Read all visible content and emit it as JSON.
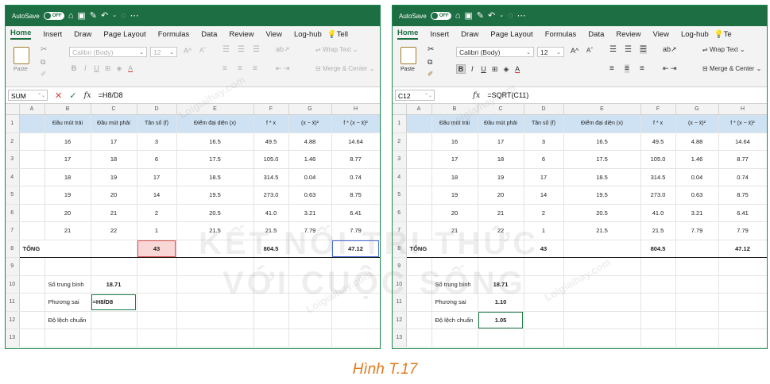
{
  "windows": [
    {
      "id": "left",
      "titlebar": {
        "autosave": "AutoSave",
        "toggle": "OFF"
      },
      "tabs": [
        "Home",
        "Insert",
        "Draw",
        "Page Layout",
        "Formulas",
        "Data",
        "Review",
        "View",
        "Log-hub",
        "Tell"
      ],
      "ribbon": {
        "paste": "Paste",
        "font_name": "Calibri (Body)",
        "font_size": "12",
        "wrap_text": "Wrap Text",
        "merge_center": "Merge & Center",
        "font_letter": "A",
        "bold": "B",
        "italic": "I",
        "underline": "U"
      },
      "formula_bar": {
        "name_box": "SUM",
        "fx": "fx",
        "cancel": "✕",
        "enter": "✓",
        "content": "=H8/D8"
      },
      "selected_cells": [
        "D8",
        "H8",
        "C11"
      ],
      "edit_cell": "C11"
    },
    {
      "id": "right",
      "titlebar": {
        "autosave": "AutoSave",
        "toggle": "OFF"
      },
      "tabs": [
        "Home",
        "Insert",
        "Draw",
        "Page Layout",
        "Formulas",
        "Data",
        "Review",
        "View",
        "Log-hub",
        "Te"
      ],
      "ribbon": {
        "paste": "Paste",
        "font_name": "Calibri (Body)",
        "font_size": "12",
        "wrap_text": "Wrap Text",
        "merge_center": "Merge & Center",
        "font_letter": "A",
        "bold": "B",
        "italic": "I",
        "underline": "U"
      },
      "formula_bar": {
        "name_box": "C12",
        "fx": "fx",
        "cancel": "",
        "enter": "",
        "content": "=SQRT(C11)"
      },
      "selected_cells": [
        "C12"
      ],
      "edit_cell": ""
    }
  ],
  "sheet": {
    "columns": [
      "A",
      "B",
      "C",
      "D",
      "E",
      "F",
      "G",
      "H"
    ],
    "row_numbers": [
      "1",
      "2",
      "3",
      "4",
      "5",
      "6",
      "7",
      "8",
      "9",
      "10",
      "11",
      "12",
      "13"
    ],
    "headers": [
      "Đầu mút trái",
      "Đầu mút phải",
      "Tần số (f)",
      "Điểm đại diện (x)",
      "f * x",
      "(x − x̄)²",
      "f * (x − x̄)²"
    ],
    "rows": [
      [
        "16",
        "17",
        "3",
        "16.5",
        "49.5",
        "4.88",
        "14.64"
      ],
      [
        "17",
        "18",
        "6",
        "17.5",
        "105.0",
        "1.46",
        "8.77"
      ],
      [
        "18",
        "19",
        "17",
        "18.5",
        "314.5",
        "0.04",
        "0.74"
      ],
      [
        "19",
        "20",
        "14",
        "19.5",
        "273.0",
        "0.63",
        "8.75"
      ],
      [
        "20",
        "21",
        "2",
        "20.5",
        "41.0",
        "3.21",
        "6.41"
      ],
      [
        "21",
        "22",
        "1",
        "21.5",
        "21.5",
        "7.79",
        "7.79"
      ]
    ],
    "total_label": "TỔNG",
    "total_freq": "43",
    "total_fx": "804.5",
    "total_var": "47.12",
    "stat_labels": {
      "mean": "Số trung bình",
      "variance": "Phương sai",
      "std": "Độ lệch chuẩn"
    },
    "left_stats": {
      "mean": "18.71",
      "variance": "=H8/D8",
      "std": ""
    },
    "right_stats": {
      "mean": "18.71",
      "variance": "1.10",
      "std": "1.05"
    }
  },
  "caption": "Hình T.17",
  "watermark": {
    "brand": "Loigiaihay.com",
    "line1": "KẾT NỐI TRI THỨC",
    "line2": "VỚI CUỘC SỐNG"
  }
}
